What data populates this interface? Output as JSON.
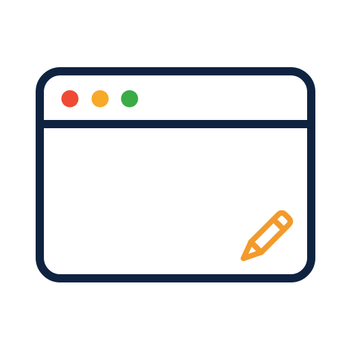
{
  "icon": {
    "name": "browser-window-edit-icon",
    "colors": {
      "frame": "#0f2341",
      "background": "#ffffff",
      "dot_close": "#ef4a33",
      "dot_minimize": "#f7a928",
      "dot_maximize": "#3aab47",
      "pencil": "#f39a2c"
    },
    "parts": {
      "window": "window-frame-icon",
      "controls": [
        "close-dot-icon",
        "minimize-dot-icon",
        "maximize-dot-icon"
      ],
      "pencil": "pencil-icon"
    }
  }
}
